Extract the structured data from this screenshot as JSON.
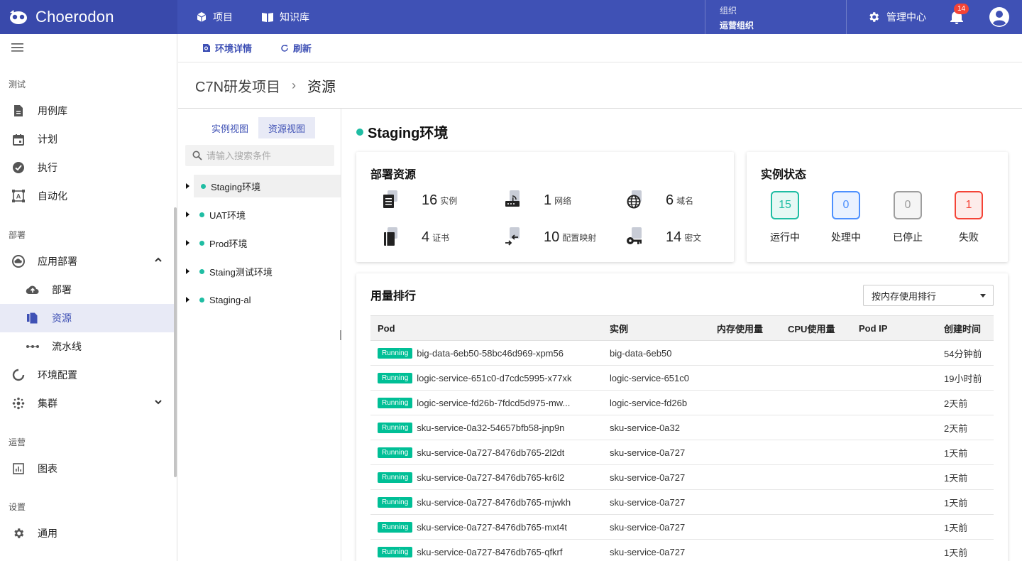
{
  "brand": "Choerodon",
  "topnav": {
    "projects": "项目",
    "knowledge": "知识库"
  },
  "org": {
    "label": "组织",
    "value": "运营组织"
  },
  "mgmt": "管理中心",
  "notifications": "14",
  "sidebar": {
    "sections": {
      "test": "测试",
      "deploy": "部署",
      "ops": "运营",
      "settings": "设置"
    },
    "items": {
      "caselib": "用例库",
      "plan": "计划",
      "exec": "执行",
      "auto": "自动化",
      "appdeploy": "应用部署",
      "deploy": "部署",
      "resource": "资源",
      "pipeline": "流水线",
      "envconfig": "环境配置",
      "cluster": "集群",
      "charts": "图表",
      "general": "通用"
    }
  },
  "subbar": {
    "envdetail": "环境详情",
    "refresh": "刷新"
  },
  "breadcrumb": {
    "project": "C7N研发项目",
    "page": "资源"
  },
  "tree": {
    "tabs": [
      "实例视图",
      "资源视图"
    ],
    "search_placeholder": "请输入搜索条件",
    "nodes": [
      "Staging环境",
      "UAT环境",
      "Prod环境",
      "Staing测试环境",
      "Staging-al"
    ]
  },
  "env_title": "Staging环境",
  "deploy_res": {
    "title": "部署资源",
    "items": [
      {
        "num": "16",
        "label": "实例"
      },
      {
        "num": "1",
        "label": "网络"
      },
      {
        "num": "6",
        "label": "域名"
      },
      {
        "num": "4",
        "label": "证书"
      },
      {
        "num": "10",
        "label": "配置映射"
      },
      {
        "num": "14",
        "label": "密文"
      }
    ]
  },
  "instance_status": {
    "title": "实例状态",
    "items": [
      {
        "num": "15",
        "label": "运行中",
        "color": "#1fbda3",
        "bg": "#e6f8f4"
      },
      {
        "num": "0",
        "label": "处理中",
        "color": "#4d90fe",
        "bg": "#eaf2ff"
      },
      {
        "num": "0",
        "label": "已停止",
        "color": "#9e9e9e",
        "bg": "#f5f5f5"
      },
      {
        "num": "1",
        "label": "失败",
        "color": "#f44336",
        "bg": "#fdecea"
      }
    ]
  },
  "usage": {
    "title": "用量排行",
    "sort_value": "按内存使用排行",
    "headers": [
      "Pod",
      "实例",
      "内存使用量",
      "CPU使用量",
      "Pod IP",
      "创建时间"
    ],
    "status_label": "Running",
    "rows": [
      {
        "pod": "big-data-6eb50-58bc46d969-xpm56",
        "inst": "big-data-6eb50",
        "time": "54分钟前"
      },
      {
        "pod": "logic-service-651c0-d7cdc5995-x77xk",
        "inst": "logic-service-651c0",
        "time": "19小时前"
      },
      {
        "pod": "logic-service-fd26b-7fdcd5d975-mw...",
        "inst": "logic-service-fd26b",
        "time": "2天前"
      },
      {
        "pod": "sku-service-0a32-54657bfb58-jnp9n",
        "inst": "sku-service-0a32",
        "time": "2天前"
      },
      {
        "pod": "sku-service-0a727-8476db765-2l2dt",
        "inst": "sku-service-0a727",
        "time": "1天前"
      },
      {
        "pod": "sku-service-0a727-8476db765-kr6l2",
        "inst": "sku-service-0a727",
        "time": "1天前"
      },
      {
        "pod": "sku-service-0a727-8476db765-mjwkh",
        "inst": "sku-service-0a727",
        "time": "1天前"
      },
      {
        "pod": "sku-service-0a727-8476db765-mxt4t",
        "inst": "sku-service-0a727",
        "time": "1天前"
      },
      {
        "pod": "sku-service-0a727-8476db765-qfkrf",
        "inst": "sku-service-0a727",
        "time": "1天前"
      }
    ]
  }
}
